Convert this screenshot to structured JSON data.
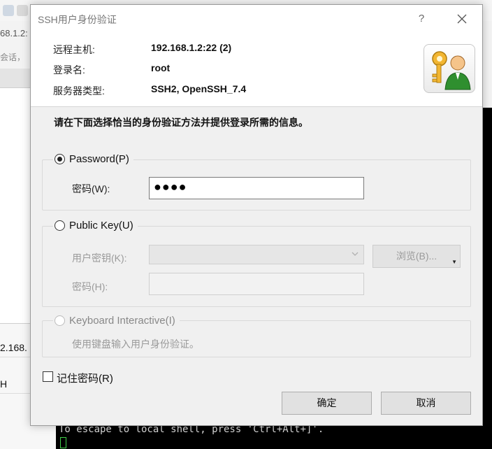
{
  "background": {
    "address_fragment": "68.1.2:",
    "sessions_fragment": "会话，​",
    "rows": [
      "2.168.",
      "H"
    ],
    "terminal_line": "To escape to local shell, press 'Ctrl+Alt+]'."
  },
  "dialog": {
    "title": "SSH用户身份验证",
    "help_symbol": "?",
    "info": {
      "host_label": "远程主机:",
      "host_value": "192.168.1.2:22 (2)",
      "login_label": "登录名:",
      "login_value": "root",
      "server_label": "服务器类型:",
      "server_value": "SSH2, OpenSSH_7.4"
    },
    "instruction": "请在下面选择恰当的身份验证方法并提供登录所需的信息。",
    "password_method": {
      "label": "Password(P)",
      "selected": true,
      "field_label": "密码(W):",
      "value_masked": "●●●●"
    },
    "public_key_method": {
      "label": "Public Key(U)",
      "selected": false,
      "key_label": "用户密钥(K):",
      "browse_label": "浏览(B)...",
      "passphrase_label": "密码(H):"
    },
    "keyboard_method": {
      "label": "Keyboard Interactive(I)",
      "hint": "使用键盘输入用户身份验证。"
    },
    "remember_label": "记住密码(R)",
    "ok_label": "确定",
    "cancel_label": "取消"
  },
  "colors": {
    "terminal_bg": "#000000",
    "cursor": "#3fd04a",
    "dialog_bg": "#f0f0f0"
  }
}
